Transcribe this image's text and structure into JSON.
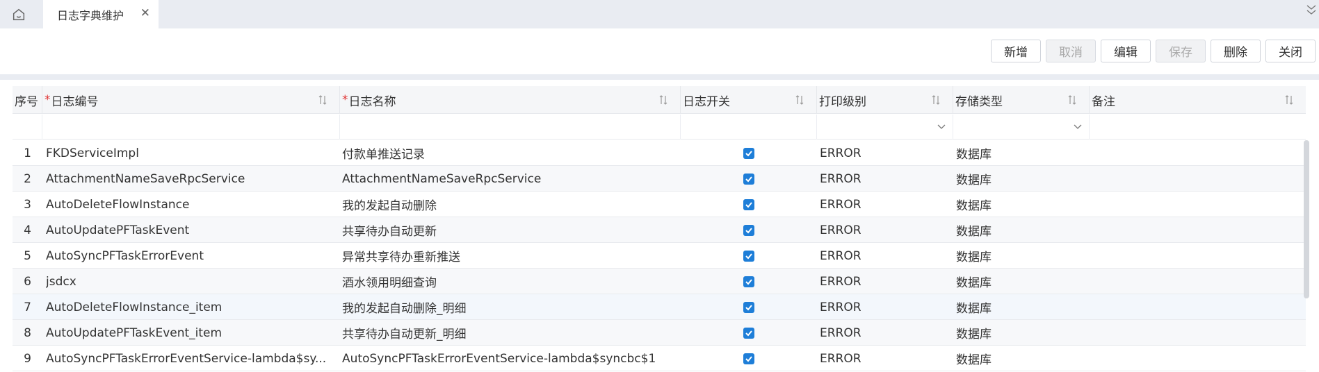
{
  "tabs": {
    "home_icon": "home-icon",
    "active_label": "日志字典维护",
    "close_glyph": "✕"
  },
  "toolbar": {
    "add": "新增",
    "cancel": "取消",
    "edit": "编辑",
    "save": "保存",
    "delete": "删除",
    "close": "关闭"
  },
  "table": {
    "columns": [
      "序号",
      "日志编号",
      "日志名称",
      "日志开关",
      "打印级别",
      "存储类型",
      "备注"
    ],
    "required_mark": "*",
    "rows": [
      {
        "idx": "1",
        "code": "FKDServiceImpl",
        "name": "付款单推送记录",
        "enabled": true,
        "level": "ERROR",
        "storage": "数据库",
        "remark": ""
      },
      {
        "idx": "2",
        "code": "AttachmentNameSaveRpcService",
        "name": "AttachmentNameSaveRpcService",
        "enabled": true,
        "level": "ERROR",
        "storage": "数据库",
        "remark": ""
      },
      {
        "idx": "3",
        "code": "AutoDeleteFlowInstance",
        "name": "我的发起自动删除",
        "enabled": true,
        "level": "ERROR",
        "storage": "数据库",
        "remark": ""
      },
      {
        "idx": "4",
        "code": "AutoUpdatePFTaskEvent",
        "name": "共享待办自动更新",
        "enabled": true,
        "level": "ERROR",
        "storage": "数据库",
        "remark": ""
      },
      {
        "idx": "5",
        "code": "AutoSyncPFTaskErrorEvent",
        "name": "异常共享待办重新推送",
        "enabled": true,
        "level": "ERROR",
        "storage": "数据库",
        "remark": ""
      },
      {
        "idx": "6",
        "code": "jsdcx",
        "name": "酒水领用明细查询",
        "enabled": true,
        "level": "ERROR",
        "storage": "数据库",
        "remark": ""
      },
      {
        "idx": "7",
        "code": "AutoDeleteFlowInstance_item",
        "name": "我的发起自动删除_明细",
        "enabled": true,
        "level": "ERROR",
        "storage": "数据库",
        "remark": ""
      },
      {
        "idx": "8",
        "code": "AutoUpdatePFTaskEvent_item",
        "name": "共享待办自动更新_明细",
        "enabled": true,
        "level": "ERROR",
        "storage": "数据库",
        "remark": ""
      },
      {
        "idx": "9",
        "code": "AutoSyncPFTaskErrorEventService-lambda$sy...",
        "name": "AutoSyncPFTaskErrorEventService-lambda$syncbc$1",
        "enabled": true,
        "level": "ERROR",
        "storage": "数据库",
        "remark": ""
      }
    ]
  },
  "colors": {
    "accent": "#1e7ed8",
    "required": "#e03131",
    "tabbar_bg": "#e9ecf2"
  }
}
